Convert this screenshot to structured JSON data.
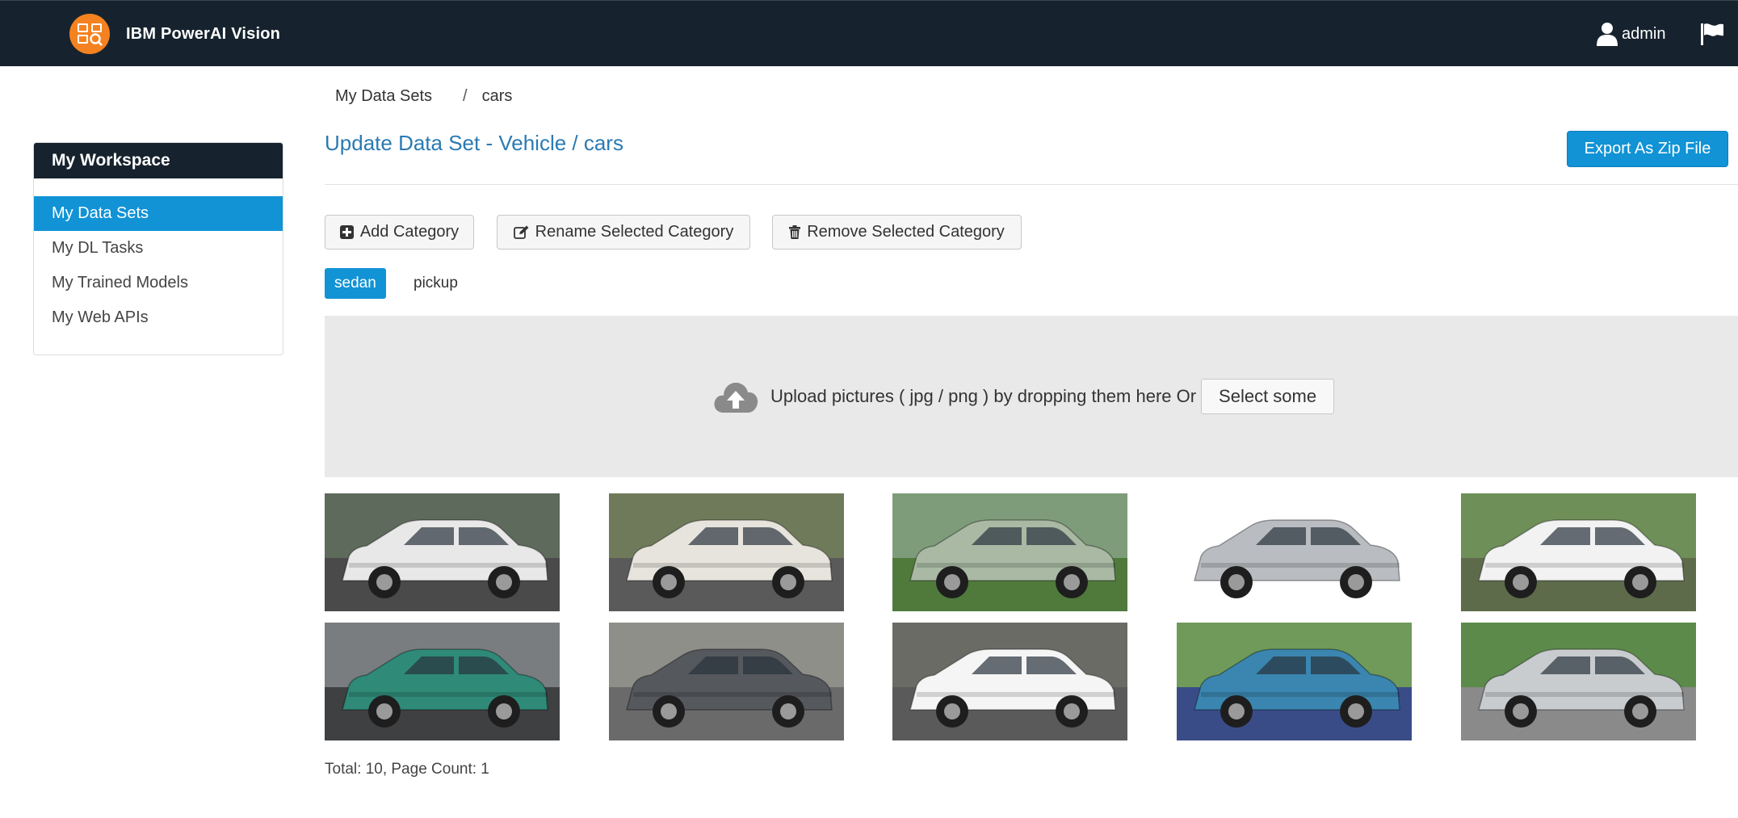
{
  "app": {
    "brand_name": "IBM PowerAI Vision",
    "user_name": "admin",
    "accent_color": "#1193d6",
    "nav_color": "#16232e",
    "logo_color": "#f58220"
  },
  "sidebar": {
    "heading": "My Workspace",
    "items": [
      {
        "label": "My Data Sets",
        "active": true
      },
      {
        "label": "My DL Tasks",
        "active": false
      },
      {
        "label": "My Trained Models",
        "active": false
      },
      {
        "label": "My Web APIs",
        "active": false
      }
    ]
  },
  "breadcrumb": {
    "root": "My Data Sets",
    "separator": "/",
    "current": "cars"
  },
  "main": {
    "title": "Update Data Set - Vehicle / cars",
    "export_label": "Export As Zip File",
    "toolbar": {
      "add_label": "Add Category",
      "rename_label": "Rename Selected Category",
      "remove_label": "Remove Selected Category"
    },
    "categories": [
      {
        "label": "sedan",
        "selected": true
      },
      {
        "label": "pickup",
        "selected": false
      }
    ],
    "upload": {
      "text": "Upload pictures ( jpg / png ) by dropping them here Or",
      "button_label": "Select some",
      "icon": "cloud-upload-icon"
    },
    "images": [
      {
        "name": "car-image-1",
        "body_color": "#e8e8e8",
        "bg_top": "#5e6a5c",
        "ground": "#4a4a4a"
      },
      {
        "name": "car-image-2",
        "body_color": "#e6e4dc",
        "bg_top": "#6f7a5a",
        "ground": "#5a5a5a"
      },
      {
        "name": "car-image-3",
        "body_color": "#a9b9a4",
        "bg_top": "#7f9c7a",
        "ground": "#4f7a3c"
      },
      {
        "name": "car-image-4",
        "body_color": "#b9bcc0",
        "bg_top": "#ffffff",
        "ground": "#ffffff"
      },
      {
        "name": "car-image-5",
        "body_color": "#f2f2f2",
        "bg_top": "#6e8f57",
        "ground": "#5d6b4a"
      },
      {
        "name": "car-image-6",
        "body_color": "#2f8a78",
        "bg_top": "#7a7d80",
        "ground": "#3e4042"
      },
      {
        "name": "car-image-7",
        "body_color": "#55585d",
        "bg_top": "#8f8f8a",
        "ground": "#6a6a6a"
      },
      {
        "name": "car-image-8",
        "body_color": "#f5f5f5",
        "bg_top": "#6b6b66",
        "ground": "#5a5a5a"
      },
      {
        "name": "car-image-9",
        "body_color": "#3a86b0",
        "bg_top": "#6f9a5a",
        "ground": "#3a4c88"
      },
      {
        "name": "car-image-10",
        "body_color": "#c9cccf",
        "bg_top": "#5c8a4a",
        "ground": "#8a8a8a"
      }
    ],
    "total_text": "Total: 10, Page Count: 1"
  }
}
